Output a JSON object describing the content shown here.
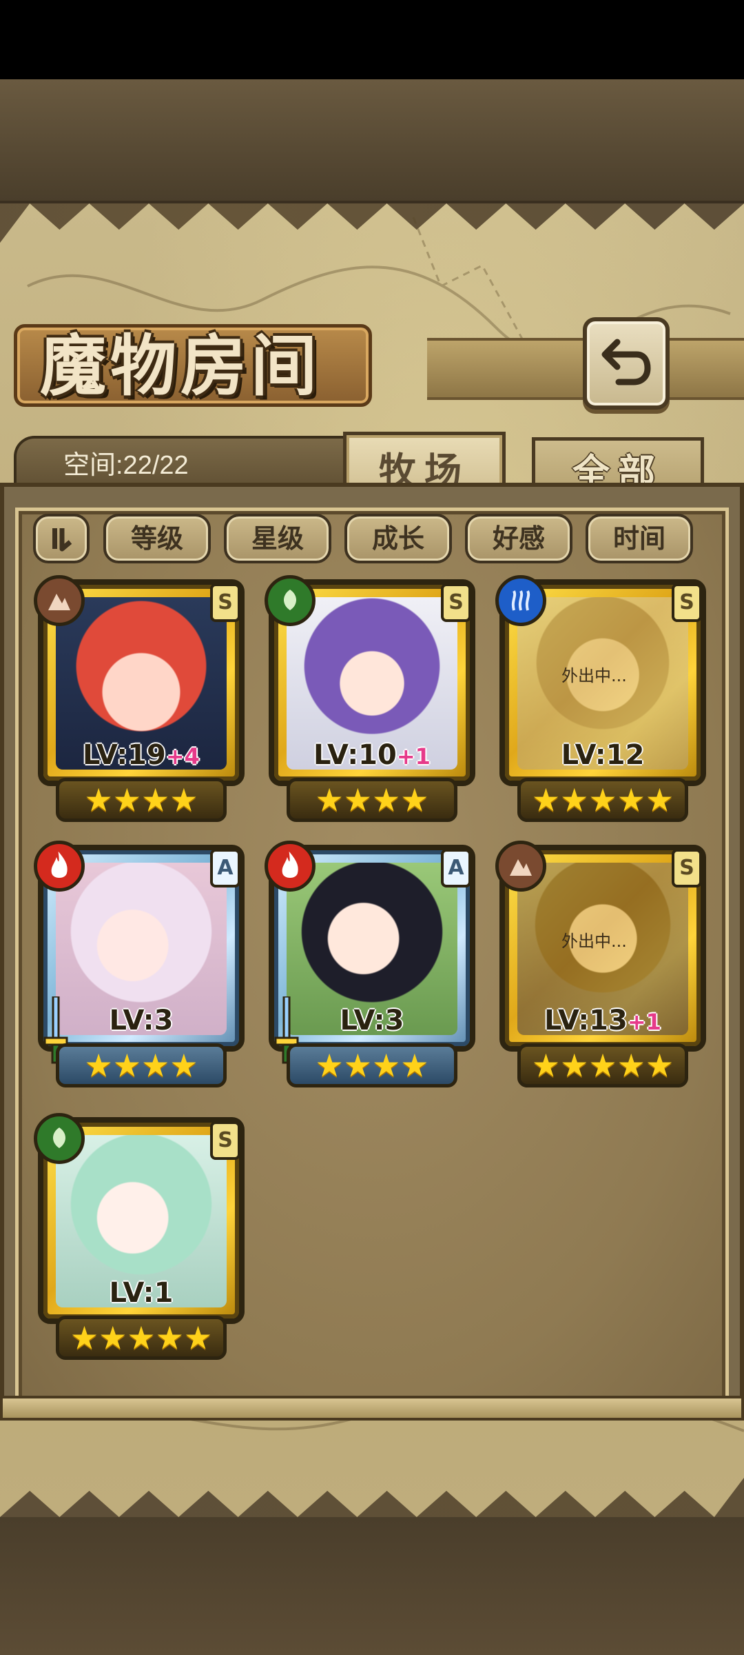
{
  "title": "魔物房间",
  "space_label": "空间:22/22",
  "tabs": [
    {
      "label": "牧场",
      "active": true
    },
    {
      "label": "全部",
      "active": false
    }
  ],
  "sort_buttons": [
    "等级",
    "星级",
    "成长",
    "好感",
    "时间"
  ],
  "cards": [
    {
      "level": "LV:19",
      "plus": "+4",
      "rank": "S",
      "frame": "gold",
      "element": "earth",
      "stars": 4,
      "status": ""
    },
    {
      "level": "LV:10",
      "plus": "+1",
      "rank": "S",
      "frame": "gold",
      "element": "nature",
      "stars": 4,
      "status": ""
    },
    {
      "level": "LV:12",
      "plus": "",
      "rank": "S",
      "frame": "gold",
      "element": "water",
      "stars": 5,
      "status": "外出中..."
    },
    {
      "level": "LV:3",
      "plus": "",
      "rank": "A",
      "frame": "blue",
      "element": "fire",
      "stars": 4,
      "status": ""
    },
    {
      "level": "LV:3",
      "plus": "",
      "rank": "A",
      "frame": "blue",
      "element": "fire",
      "stars": 4,
      "status": ""
    },
    {
      "level": "LV:13",
      "plus": "+1",
      "rank": "S",
      "frame": "gold",
      "element": "earth",
      "stars": 5,
      "status": "外出中..."
    },
    {
      "level": "LV:1",
      "plus": "",
      "rank": "S",
      "frame": "gold",
      "element": "nature",
      "stars": 5,
      "status": ""
    }
  ],
  "colors": {
    "fire": "#d42a1e",
    "nature": "#2f7a2a",
    "water": "#1e5ec8",
    "earth": "#7a4a30"
  }
}
